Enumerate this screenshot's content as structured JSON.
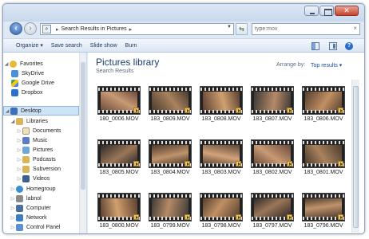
{
  "window": {
    "address": {
      "path": "Search Results in Pictures"
    },
    "search": {
      "query": "type:mov"
    }
  },
  "toolbar": {
    "organize": "Organize ▾",
    "save_search": "Save search",
    "slide_show": "Slide show",
    "burn": "Burn"
  },
  "nav": {
    "favorites": "Favorites",
    "favorite_items": [
      "SkyDrive",
      "Google Drive",
      "Dropbox"
    ],
    "desktop": "Desktop",
    "libraries": "Libraries",
    "library_items": [
      "Documents",
      "Music",
      "Pictures",
      "Podcasts",
      "Subversion",
      "Videos"
    ],
    "other_items": [
      "Homegroup",
      "labnol",
      "Computer",
      "Network",
      "Control Panel"
    ]
  },
  "content": {
    "title": "Pictures library",
    "subtitle": "Search Results",
    "arrange_label": "Arrange by:",
    "arrange_value": "Top results ▾"
  },
  "files": [
    "180_0006.MOV",
    "183_0809.MOV",
    "183_0808.MOV",
    "183_0807.MOV",
    "183_0806.MOV",
    "183_0805.MOV",
    "183_0804.MOV",
    "183_0803.MOV",
    "183_0802.MOV",
    "183_0801.MOV",
    "183_0800.MOV",
    "183_0799.MOV",
    "183_0798.MOV",
    "183_0797.MOV",
    "183_0796.MOV"
  ],
  "colors": {
    "accent": "#1e3a6e",
    "selection": "#cde3f8",
    "arrange_link": "#1e4f9a"
  }
}
